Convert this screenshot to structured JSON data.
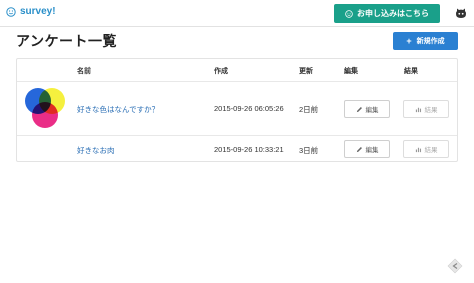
{
  "navbar": {
    "brand": "survey!",
    "signup_label": "お申し込みはこちら"
  },
  "page": {
    "title": "アンケート一覧",
    "new_button_label": "新規作成"
  },
  "table": {
    "columns": [
      "名前",
      "作成",
      "更新",
      "編集",
      "結果"
    ],
    "rows": [
      {
        "name": "好きな色はなんですか？",
        "created": "2015-09-26 06:05:26",
        "updated": "2日前",
        "edit_label": "編集",
        "result_label": "結果"
      },
      {
        "name": "好きなお肉",
        "created": "2015-09-26 10:33:21",
        "updated": "3日前",
        "edit_label": "編集",
        "result_label": "結果"
      }
    ]
  },
  "colors": {
    "brand": "#2a8fc9",
    "signup": "#1aa08a",
    "primary": "#2a80d2",
    "link": "#2b6fb5"
  },
  "icons": {
    "brand": "smile-icon",
    "signup": "smile-icon",
    "account": "octocat-icon",
    "new": "plus-icon",
    "edit": "pencil-icon",
    "result": "bar-chart-icon",
    "corner": "arrow-icon"
  }
}
